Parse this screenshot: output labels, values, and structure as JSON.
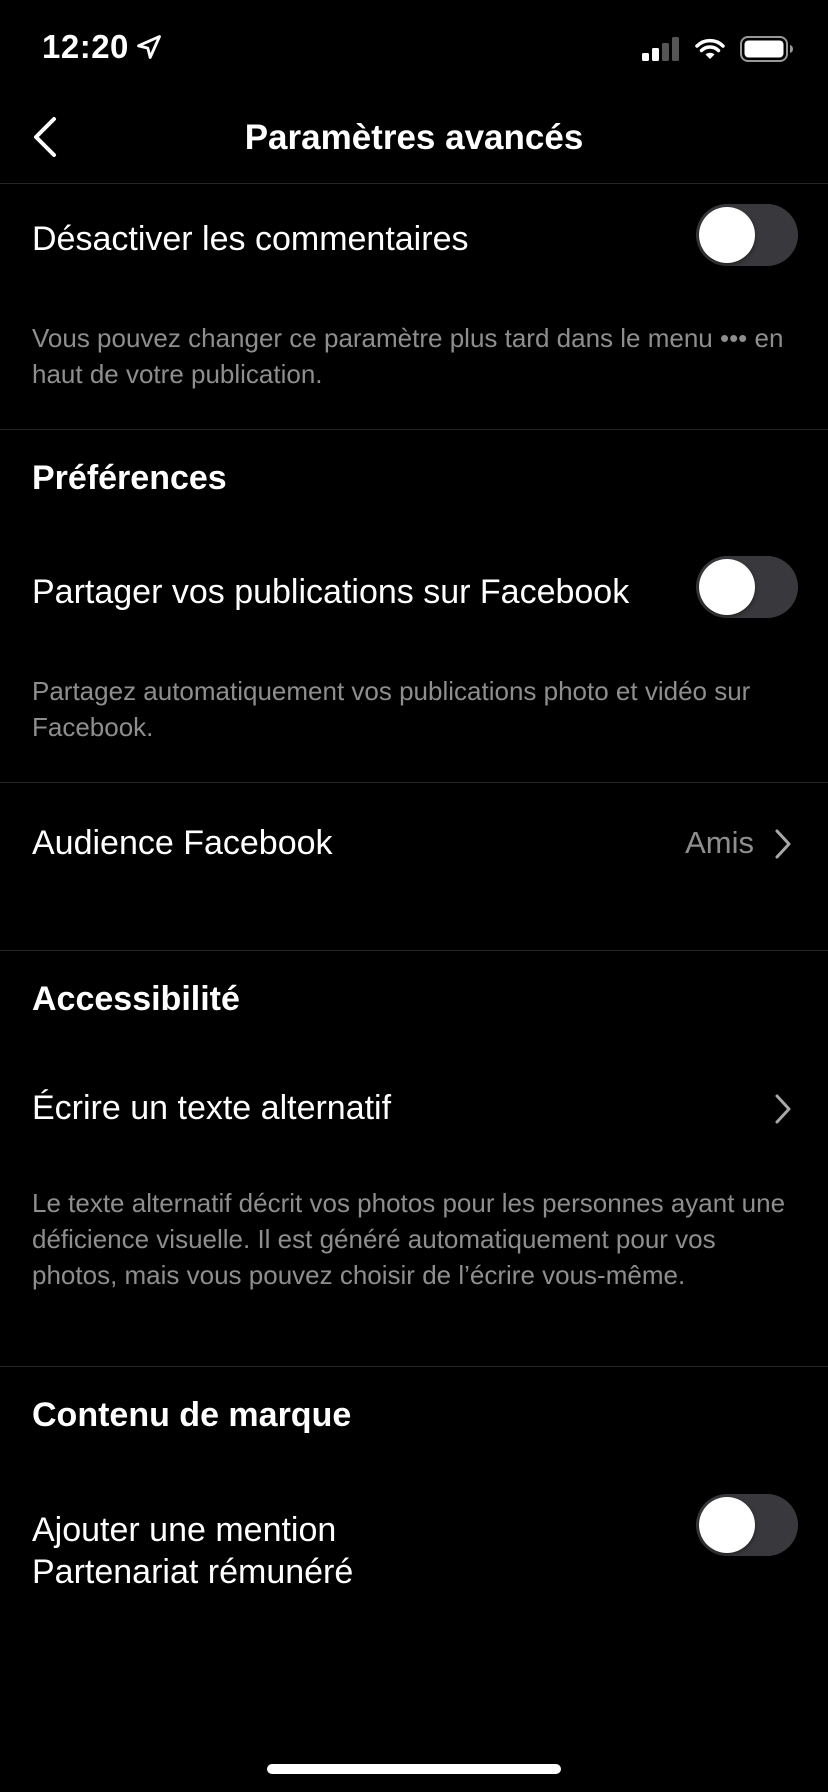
{
  "status": {
    "time": "12:20",
    "location_icon": "location-arrow-icon",
    "signal_icon": "cellular-signal-icon",
    "wifi_icon": "wifi-icon",
    "battery_icon": "battery-icon"
  },
  "header": {
    "title": "Paramètres avancés",
    "back_icon": "chevron-left-icon"
  },
  "comments": {
    "label": "Désactiver les commentaires",
    "toggle_on": false,
    "helper": "Vous pouvez changer ce paramètre plus tard dans le menu ••• en haut de votre publication."
  },
  "preferences": {
    "section_title": "Préférences",
    "share_label": "Partager vos publications sur Facebook",
    "share_toggle_on": false,
    "share_helper": "Partagez automatiquement vos publications photo et vidéo sur Facebook.",
    "audience_label": "Audience Facebook",
    "audience_value": "Amis"
  },
  "accessibility": {
    "section_title": "Accessibilité",
    "alt_text_label": "Écrire un texte alternatif",
    "alt_text_helper": "Le texte alternatif décrit vos photos pour les personnes ayant une déficience visuelle. Il est généré automatiquement pour vos photos, mais vous pouvez choisir de l’écrire vous-même."
  },
  "branded": {
    "section_title": "Contenu de marque",
    "paid_label_line1": "Ajouter une mention",
    "paid_label_line2": "Partenariat rémunéré",
    "paid_toggle_on": false
  },
  "colors": {
    "background": "#000000",
    "text": "#ffffff",
    "secondary_text": "#8e8e8e",
    "toggle_off_track": "#39393d",
    "divider": "#262626"
  }
}
